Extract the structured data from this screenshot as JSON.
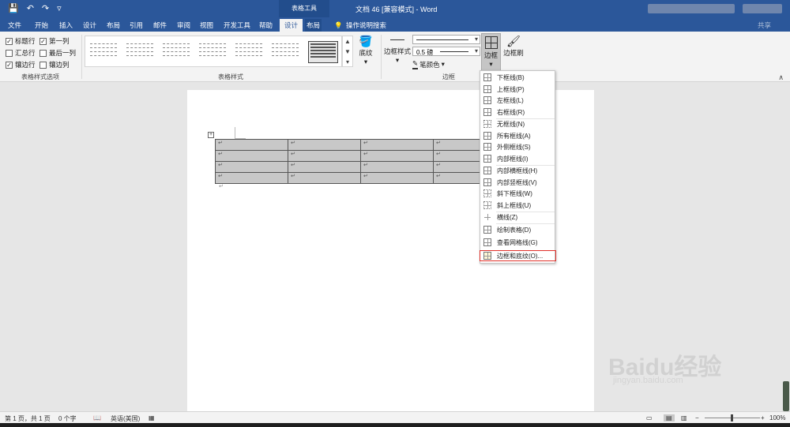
{
  "titlebar": {
    "context_tab": "表格工具",
    "title": "文档 46 [兼容模式] - Word",
    "save_icon": "save-icon",
    "undo_icon": "undo-icon",
    "redo_icon": "redo-icon",
    "share": "共享"
  },
  "tabs": [
    "文件",
    "开始",
    "插入",
    "设计",
    "布局",
    "引用",
    "邮件",
    "审阅",
    "视图",
    "开发工具",
    "帮助",
    "设计",
    "布局"
  ],
  "tell_me": "操作说明搜索",
  "ribbon": {
    "style_options": {
      "items": [
        {
          "label": "标题行",
          "checked": true
        },
        {
          "label": "第一列",
          "checked": true
        },
        {
          "label": "汇总行",
          "checked": false
        },
        {
          "label": "最后一列",
          "checked": false
        },
        {
          "label": "镶边行",
          "checked": true
        },
        {
          "label": "镶边列",
          "checked": false
        }
      ],
      "group_label": "表格样式选项"
    },
    "table_styles": {
      "group_label": "表格样式",
      "shading": "底纹"
    },
    "borders": {
      "group_label": "边框",
      "border_styles": "边框样式",
      "pen_weight": "0.5 磅",
      "pen_color": "笔颜色",
      "borders_button": "边框",
      "border_painter": "边框刷"
    }
  },
  "menu": {
    "items": [
      "下框线(B)",
      "上框线(P)",
      "左框线(L)",
      "右框线(R)",
      "无框线(N)",
      "所有框线(A)",
      "外侧框线(S)",
      "内部框线(I)",
      "内部横框线(H)",
      "内部竖框线(V)",
      "斜下框线(W)",
      "斜上框线(U)",
      "横线(Z)",
      "绘制表格(D)",
      "查看网格线(G)",
      "边框和底纹(O)..."
    ],
    "highlighted": "边框和底纹(O)..."
  },
  "document": {
    "cell_mark": "↵",
    "paragraph_mark": "↵"
  },
  "status": {
    "page": "第 1 页，共 1 页",
    "words": "0 个字",
    "language": "英语(美国)",
    "zoom": "100%"
  },
  "watermark": {
    "text": "Baidu经验",
    "sub": "jingyan.baidu.com"
  },
  "colors": {
    "brand": "#2b579a",
    "highlight_border": "#e0312a"
  }
}
